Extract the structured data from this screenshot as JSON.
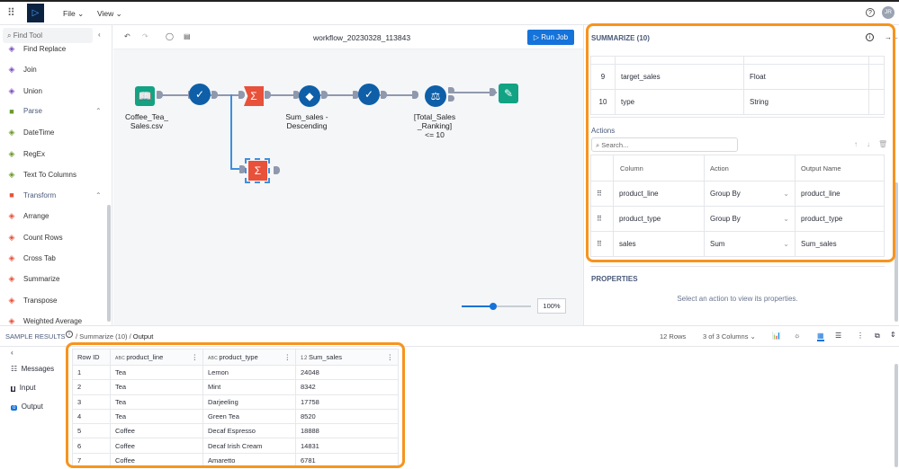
{
  "app": {
    "logo": "alteryx-logo",
    "menu": [
      {
        "label": "File"
      },
      {
        "label": "View"
      }
    ],
    "user_initials": "JR"
  },
  "sidebar": {
    "search_placeholder": "Find Tool",
    "items": [
      {
        "label": "Find Replace",
        "icon": "find-replace-icon",
        "color": "#7b4fc0"
      },
      {
        "label": "Join",
        "icon": "join-icon",
        "color": "#7b4fc0"
      },
      {
        "label": "Union",
        "icon": "union-icon",
        "color": "#7b4fc0"
      },
      {
        "label": "Parse",
        "icon": "parse-group-icon",
        "group": true,
        "color": "#6a9a2b"
      },
      {
        "label": "DateTime",
        "icon": "datetime-icon",
        "color": "#6a9a2b"
      },
      {
        "label": "RegEx",
        "icon": "regex-icon",
        "color": "#6a9a2b"
      },
      {
        "label": "Text To Columns",
        "icon": "text-to-columns-icon",
        "color": "#6a9a2b"
      },
      {
        "label": "Transform",
        "icon": "transform-group-icon",
        "group": true,
        "color": "#e8513a"
      },
      {
        "label": "Arrange",
        "icon": "arrange-icon",
        "color": "#e8513a"
      },
      {
        "label": "Count Rows",
        "icon": "count-rows-icon",
        "color": "#e8513a"
      },
      {
        "label": "Cross Tab",
        "icon": "cross-tab-icon",
        "color": "#e8513a"
      },
      {
        "label": "Summarize",
        "icon": "summarize-icon",
        "color": "#e8513a"
      },
      {
        "label": "Transpose",
        "icon": "transpose-icon",
        "color": "#e8513a"
      },
      {
        "label": "Weighted Average",
        "icon": "weighted-average-icon",
        "color": "#e8513a"
      }
    ]
  },
  "canvas": {
    "workflow_name": "workflow_20230328_113843",
    "run_label": "Run Job",
    "zoom": "100%",
    "zoom_level": 0.45,
    "nodes": {
      "input": "Coffee_Tea_\nSales.csv",
      "sort": "Sum_sales -\nDescending",
      "filter": "[Total_Sales\n_Ranking]\n<= 10"
    }
  },
  "panel": {
    "title": "SUMMARIZE (10)",
    "fields": [
      {
        "num": "9",
        "name": "target_sales",
        "type": "Float"
      },
      {
        "num": "10",
        "name": "type",
        "type": "String"
      }
    ],
    "actions_title": "Actions",
    "search_placeholder": "Search...",
    "headers": [
      "Column",
      "Action",
      "Output Name"
    ],
    "actions": [
      {
        "column": "product_line",
        "action": "Group By",
        "output": "product_line"
      },
      {
        "column": "product_type",
        "action": "Group By",
        "output": "product_type"
      },
      {
        "column": "sales",
        "action": "Sum",
        "output": "Sum_sales"
      }
    ],
    "properties_title": "PROPERTIES",
    "properties_hint": "Select an action to view its properties."
  },
  "results": {
    "title": "SAMPLE RESULTS",
    "crumb1": "/ Summarize (10) /",
    "crumb2": "Output",
    "rows_count": "12 Rows",
    "columns": "3 of 3 Columns",
    "nav": [
      {
        "label": "Messages"
      },
      {
        "label": "Input"
      },
      {
        "label": "Output"
      }
    ],
    "headers": [
      "Row ID",
      "product_line",
      "product_type",
      "Sum_sales"
    ],
    "type_icons": [
      "A B C",
      "A B C",
      "1 2"
    ],
    "rows": [
      [
        "1",
        "Tea",
        "Lemon",
        "24048"
      ],
      [
        "2",
        "Tea",
        "Mint",
        "8342"
      ],
      [
        "3",
        "Tea",
        "Darjeeling",
        "17758"
      ],
      [
        "4",
        "Tea",
        "Green Tea",
        "8520"
      ],
      [
        "5",
        "Coffee",
        "Decaf Espresso",
        "18888"
      ],
      [
        "6",
        "Coffee",
        "Decaf Irish Cream",
        "14831"
      ],
      [
        "7",
        "Coffee",
        "Amaretto",
        "6781"
      ]
    ]
  },
  "colors": {
    "accent": "#1573d9",
    "highlight": "#f7941d",
    "node_blue": "#0e5fa8",
    "node_teal": "#11a384",
    "node_red": "#e8513a"
  }
}
